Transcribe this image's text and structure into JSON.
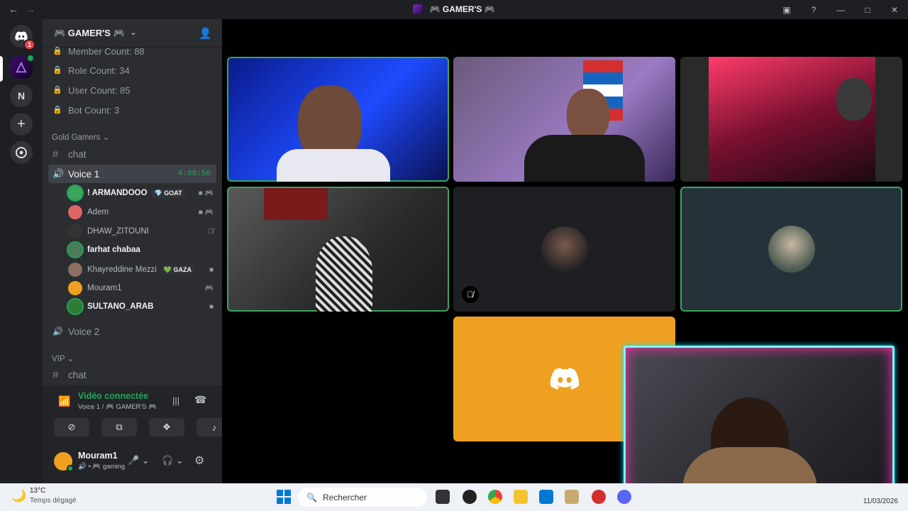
{
  "window": {
    "title": "🎮 GAMER'S 🎮",
    "back_icon": "←",
    "forward_icon": "→"
  },
  "rail": {
    "home_badge": "1",
    "dm_letter": "N"
  },
  "server": {
    "name": "🎮 GAMER'S 🎮",
    "stats": [
      {
        "label": "Member Count: 88"
      },
      {
        "label": "Role Count: 34"
      },
      {
        "label": "User Count: 85"
      },
      {
        "label": "Bot Count: 3"
      }
    ],
    "category_gold": "Gold Gamers",
    "channel_chat": "chat",
    "voice1": {
      "name": "Voice 1",
      "timer": "4:08:56"
    },
    "voice_users": [
      {
        "name": "! ARMANDOOO",
        "tag": "💎 GOAT",
        "color": "#3ba55d"
      },
      {
        "name": "Adem",
        "tag": "",
        "color": "#e06666"
      },
      {
        "name": "DHAW_ZITOUNI",
        "tag": "",
        "color": "#555"
      },
      {
        "name": "farhat chabaa",
        "tag": "",
        "color": "#3ba55d"
      },
      {
        "name": "Khayreddine Mezzi",
        "tag": "💚 GAZA",
        "color": "#8d6e63"
      },
      {
        "name": "Mouram1",
        "tag": "",
        "color": "#f0a020"
      },
      {
        "name": "SULTANO_ARAB",
        "tag": "",
        "color": "#2e7d32"
      }
    ],
    "voice2": "Voice 2",
    "category_vip": "VIP",
    "vip_chat": "chat"
  },
  "voice_panel": {
    "status": "Vidéo connectée",
    "location": "Voice 1 / 🎮 GAMER'S 🎮"
  },
  "user_panel": {
    "username": "Mouram1",
    "status": "🔊 • 🎮 gaming"
  },
  "taskbar": {
    "temperature": "13°C",
    "weather": "Temps dégagé",
    "search_placeholder": "Rechercher",
    "date": "11/03/2026"
  },
  "colors": {
    "accent_green": "#3ba55d",
    "discord_blue": "#5865f2",
    "tile_orange": "#f0a020",
    "stream_glow": "#00e5ff"
  }
}
